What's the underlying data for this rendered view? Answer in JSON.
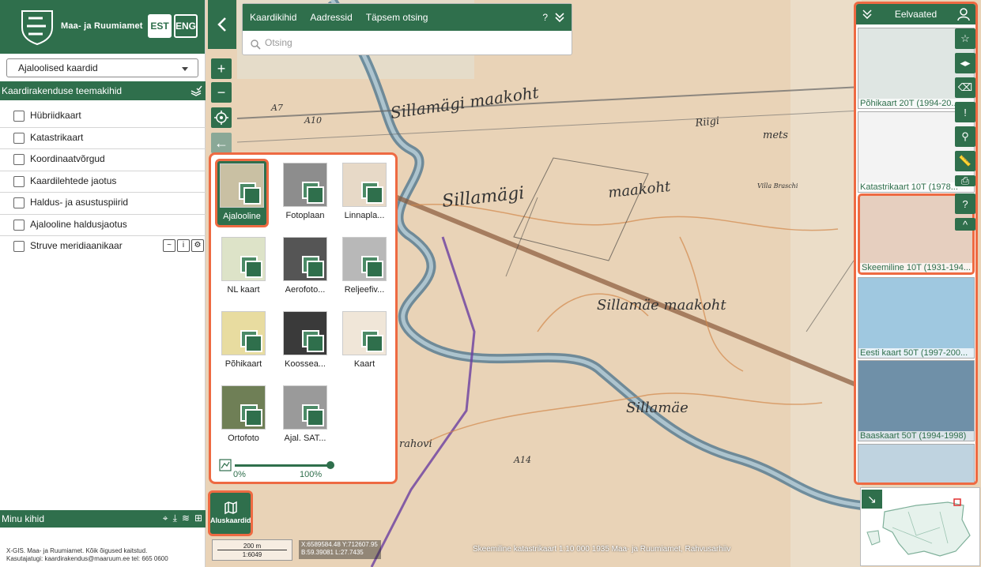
{
  "header": {
    "org_name": "Maa- ja Ruumiamet",
    "lang_est": "EST",
    "lang_eng": "ENG"
  },
  "layer_select": {
    "value": "Ajaloolised kaardid"
  },
  "theme_layers": {
    "title": "Kaardirakenduse teemakihid",
    "items": [
      "Hübriidkaart",
      "Katastrikaart",
      "Koordinaatvõrgud",
      "Kaardilehtede jaotus",
      "Haldus- ja asustuspiirid",
      "Ajalooline haldusjaotus",
      "Struve meridiaanikaar"
    ]
  },
  "my_layers": {
    "title": "Minu kihid"
  },
  "footer": {
    "line1": "X-GIS. Maa- ja Ruumiamet. Kõik õigused kaitstud.",
    "line2": "Kasutajatugi: kaardirakendus@maaruum.ee tel: 665 0600"
  },
  "search": {
    "tab1": "Kaardikihid",
    "tab2": "Aadressid",
    "tab3": "Täpsem otsing",
    "help": "?",
    "placeholder": "Otsing"
  },
  "basemaps": {
    "items": [
      "Ajalooline",
      "Fotoplaan",
      "Linnapla...",
      "NL kaart",
      "Aerofoto...",
      "Reljeefiv...",
      "Põhikaart",
      "Koossea...",
      "Kaart",
      "Ortofoto",
      "Ajal. SAT..."
    ],
    "opacity_min": "0%",
    "opacity_max": "100%",
    "opacity_value": 1.0,
    "button_label": "Aluskaardid"
  },
  "scale": {
    "distance": "200 m",
    "ratio": "1:6049"
  },
  "coords": {
    "line1": "X:6589584.48 Y:712607.95",
    "line2": "B:59.39081 L:27.7435"
  },
  "attribution": "Skeemiline katastrikaart 1:10 000 1935 Maa- ja Ruumiamet, Rahvusarhiiv",
  "preview": {
    "title": "Eelvaated",
    "items": [
      "Põhikaart 20T (1994-20...",
      "Katastrikaart 10T (1978...",
      "Skeemiline 10T (1931-194...",
      "Eesti kaart 50T (1997-200...",
      "Baaskaart 50T (1994-1998)",
      ""
    ],
    "help": "?"
  },
  "map_labels": {
    "l1": "Sillamägi maakoht",
    "l2": "Sillamägi",
    "l3": "maakoht",
    "l4": "Sillamäe maakoht",
    "l5": "Sillamäe",
    "l6": "Riigi",
    "l7": "mets",
    "l8": "A14",
    "l9": "A7",
    "l10": "A10",
    "l11": "Villa Braschi",
    "l12": "rahovi"
  },
  "colors": {
    "accent": "#2f6f4c",
    "highlight": "#ee6a42",
    "map_bg": "#e9d3b7"
  }
}
